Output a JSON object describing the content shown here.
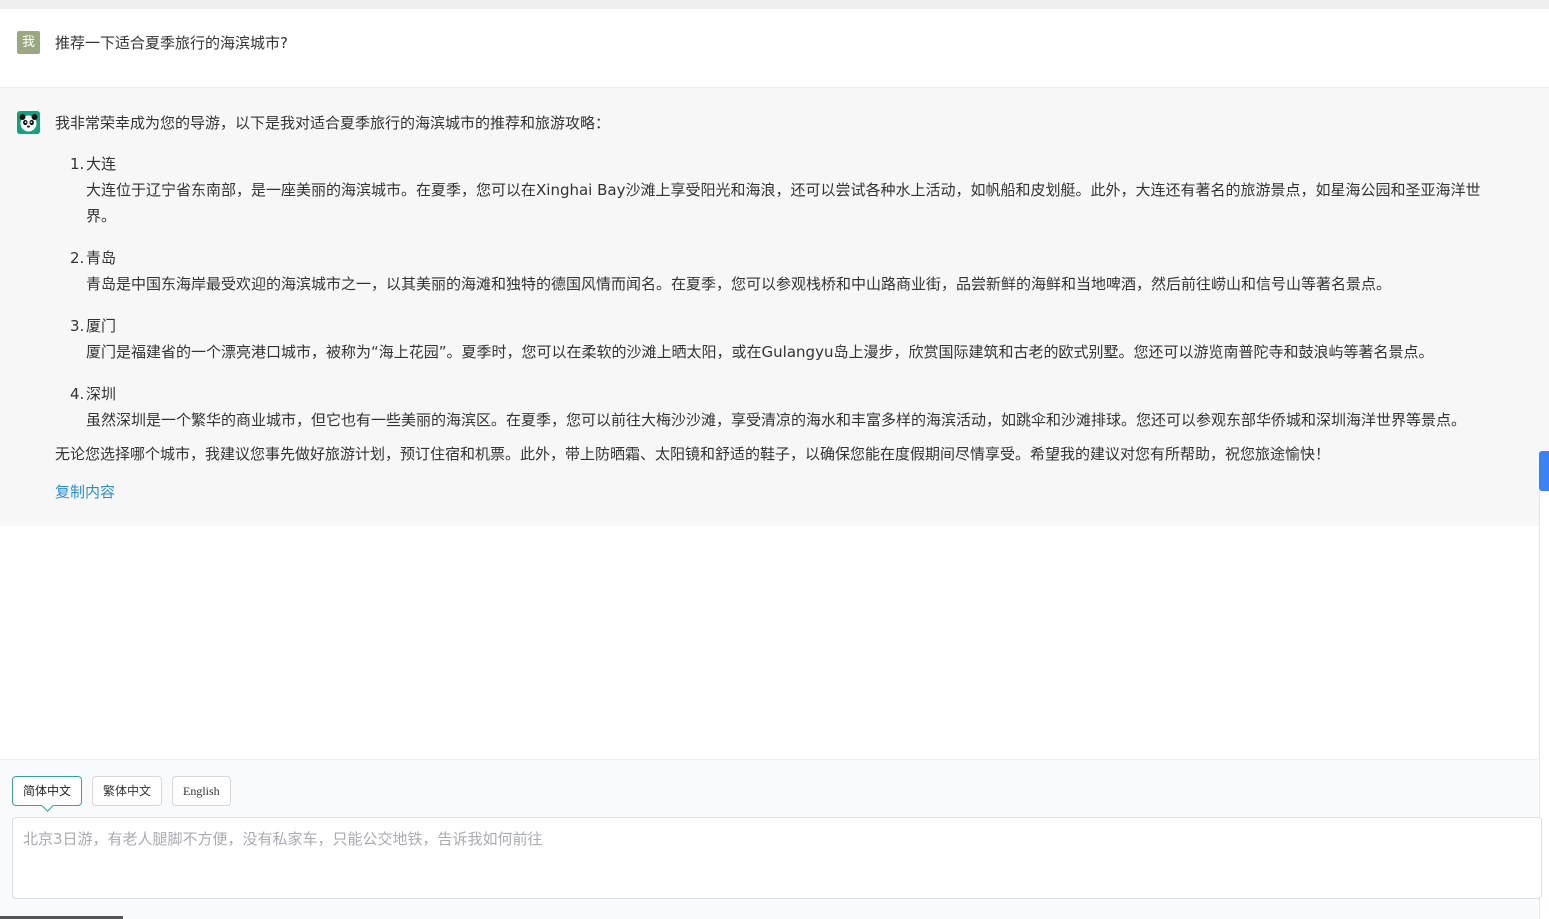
{
  "user": {
    "avatar_text": "我",
    "question": "推荐一下适合夏季旅行的海滨城市?"
  },
  "bot": {
    "avatar_icon": "panda-icon",
    "intro": "我非常荣幸成为您的导游，以下是我对适合夏季旅行的海滨城市的推荐和旅游攻略：",
    "items": [
      {
        "num": "1.",
        "title": "大连",
        "line1": "大连位于辽宁省东南部，是一座美丽的海滨城市。在夏季，您可以在Xinghai Bay沙滩上享受阳光和海浪，还可以尝试各种水上活动，如帆船和皮划艇。此外，大连还有著名的旅游景点，如星海公园和圣亚海洋世",
        "line2": "界。"
      },
      {
        "num": "2.",
        "title": "青岛",
        "line1": "青岛是中国东海岸最受欢迎的海滨城市之一，以其美丽的海滩和独特的德国风情而闻名。在夏季，您可以参观栈桥和中山路商业街，品尝新鲜的海鲜和当地啤酒，然后前往崂山和信号山等著名景点。"
      },
      {
        "num": "3.",
        "title": "厦门",
        "line1": "厦门是福建省的一个漂亮港口城市，被称为“海上花园”。夏季时，您可以在柔软的沙滩上晒太阳，或在Gulangyu岛上漫步，欣赏国际建筑和古老的欧式别墅。您还可以游览南普陀寺和鼓浪屿等著名景点。"
      },
      {
        "num": "4.",
        "title": "深圳",
        "line1": "虽然深圳是一个繁华的商业城市，但它也有一些美丽的海滨区。在夏季，您可以前往大梅沙沙滩，享受清凉的海水和丰富多样的海滨活动，如跳伞和沙滩排球。您还可以参观东部华侨城和深圳海洋世界等景点。"
      }
    ],
    "closing": "无论您选择哪个城市，我建议您事先做好旅游计划，预订住宿和机票。此外，带上防晒霜、太阳镜和舒适的鞋子，以确保您能在度假期间尽情享受。希望我的建议对您有所帮助，祝您旅途愉快！",
    "copy_label": "复制内容"
  },
  "input": {
    "languages": [
      "简体中文",
      "繁体中文",
      "English"
    ],
    "selected_language": "简体中文",
    "placeholder": "北京3日游，有老人腿脚不方便，没有私家车，只能公交地铁，告诉我如何前往",
    "value": ""
  },
  "colors": {
    "accent": "#38a39d",
    "link": "#2b8ed8",
    "bot_bg": "#f7f7f8",
    "side_tab": "#3a83f5"
  }
}
